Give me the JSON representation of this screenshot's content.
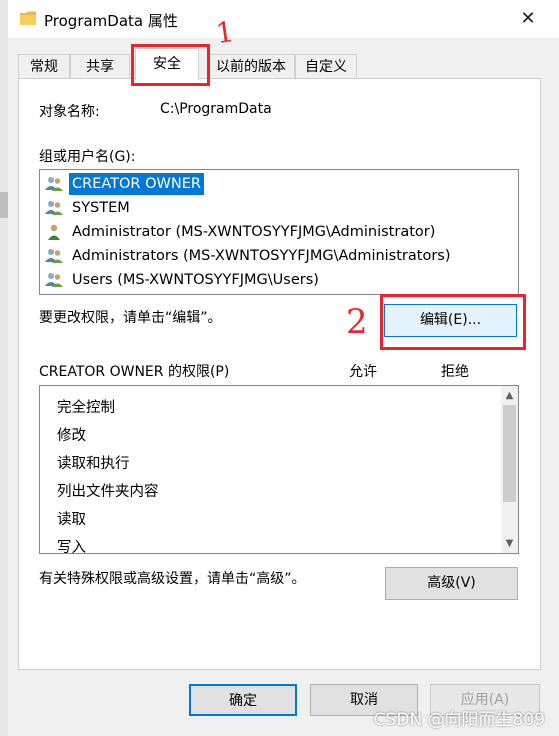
{
  "window": {
    "title": "ProgramData 属性",
    "close_glyph": "✕"
  },
  "tabs": [
    {
      "label": "常规",
      "active": false
    },
    {
      "label": "共享",
      "active": false
    },
    {
      "label": "安全",
      "active": true
    },
    {
      "label": "以前的版本",
      "active": false
    },
    {
      "label": "自定义",
      "active": false
    }
  ],
  "security": {
    "object_name_label": "对象名称:",
    "object_name_value": "C:\\ProgramData",
    "group_label": "组或用户名(G):",
    "groups": [
      {
        "label": "CREATOR OWNER",
        "icon": "users-group-icon",
        "selected": true
      },
      {
        "label": "SYSTEM",
        "icon": "users-group-icon",
        "selected": false
      },
      {
        "label": "Administrator (MS-XWNTOSYYFJMG\\Administrator)",
        "icon": "user-icon",
        "selected": false
      },
      {
        "label": "Administrators (MS-XWNTOSYYFJMG\\Administrators)",
        "icon": "users-group-icon",
        "selected": false
      },
      {
        "label": "Users (MS-XWNTOSYYFJMG\\Users)",
        "icon": "users-group-icon",
        "selected": false
      }
    ],
    "change_hint": "要更改权限，请单击“编辑”。",
    "edit_button": "编辑(E)...",
    "permissions_label": "CREATOR OWNER 的权限(P)",
    "allow_header": "允许",
    "deny_header": "拒绝",
    "permissions": [
      "完全控制",
      "修改",
      "读取和执行",
      "列出文件夹内容",
      "读取",
      "写入"
    ],
    "advanced_hint": "有关特殊权限或高级设置，请单击“高级”。",
    "advanced_button": "高级(V)"
  },
  "footer": {
    "ok_button": "确定",
    "cancel_button": "取消",
    "apply_button": "应用(A)"
  },
  "annotations": {
    "mark_1": "1",
    "mark_2": "2",
    "color": "#e8242c"
  },
  "watermark": "CSDN @向阳而生809",
  "colors": {
    "selection": "#0078d7",
    "dialog_bg": "#f0f0f0",
    "panel_bg": "#ffffff"
  }
}
